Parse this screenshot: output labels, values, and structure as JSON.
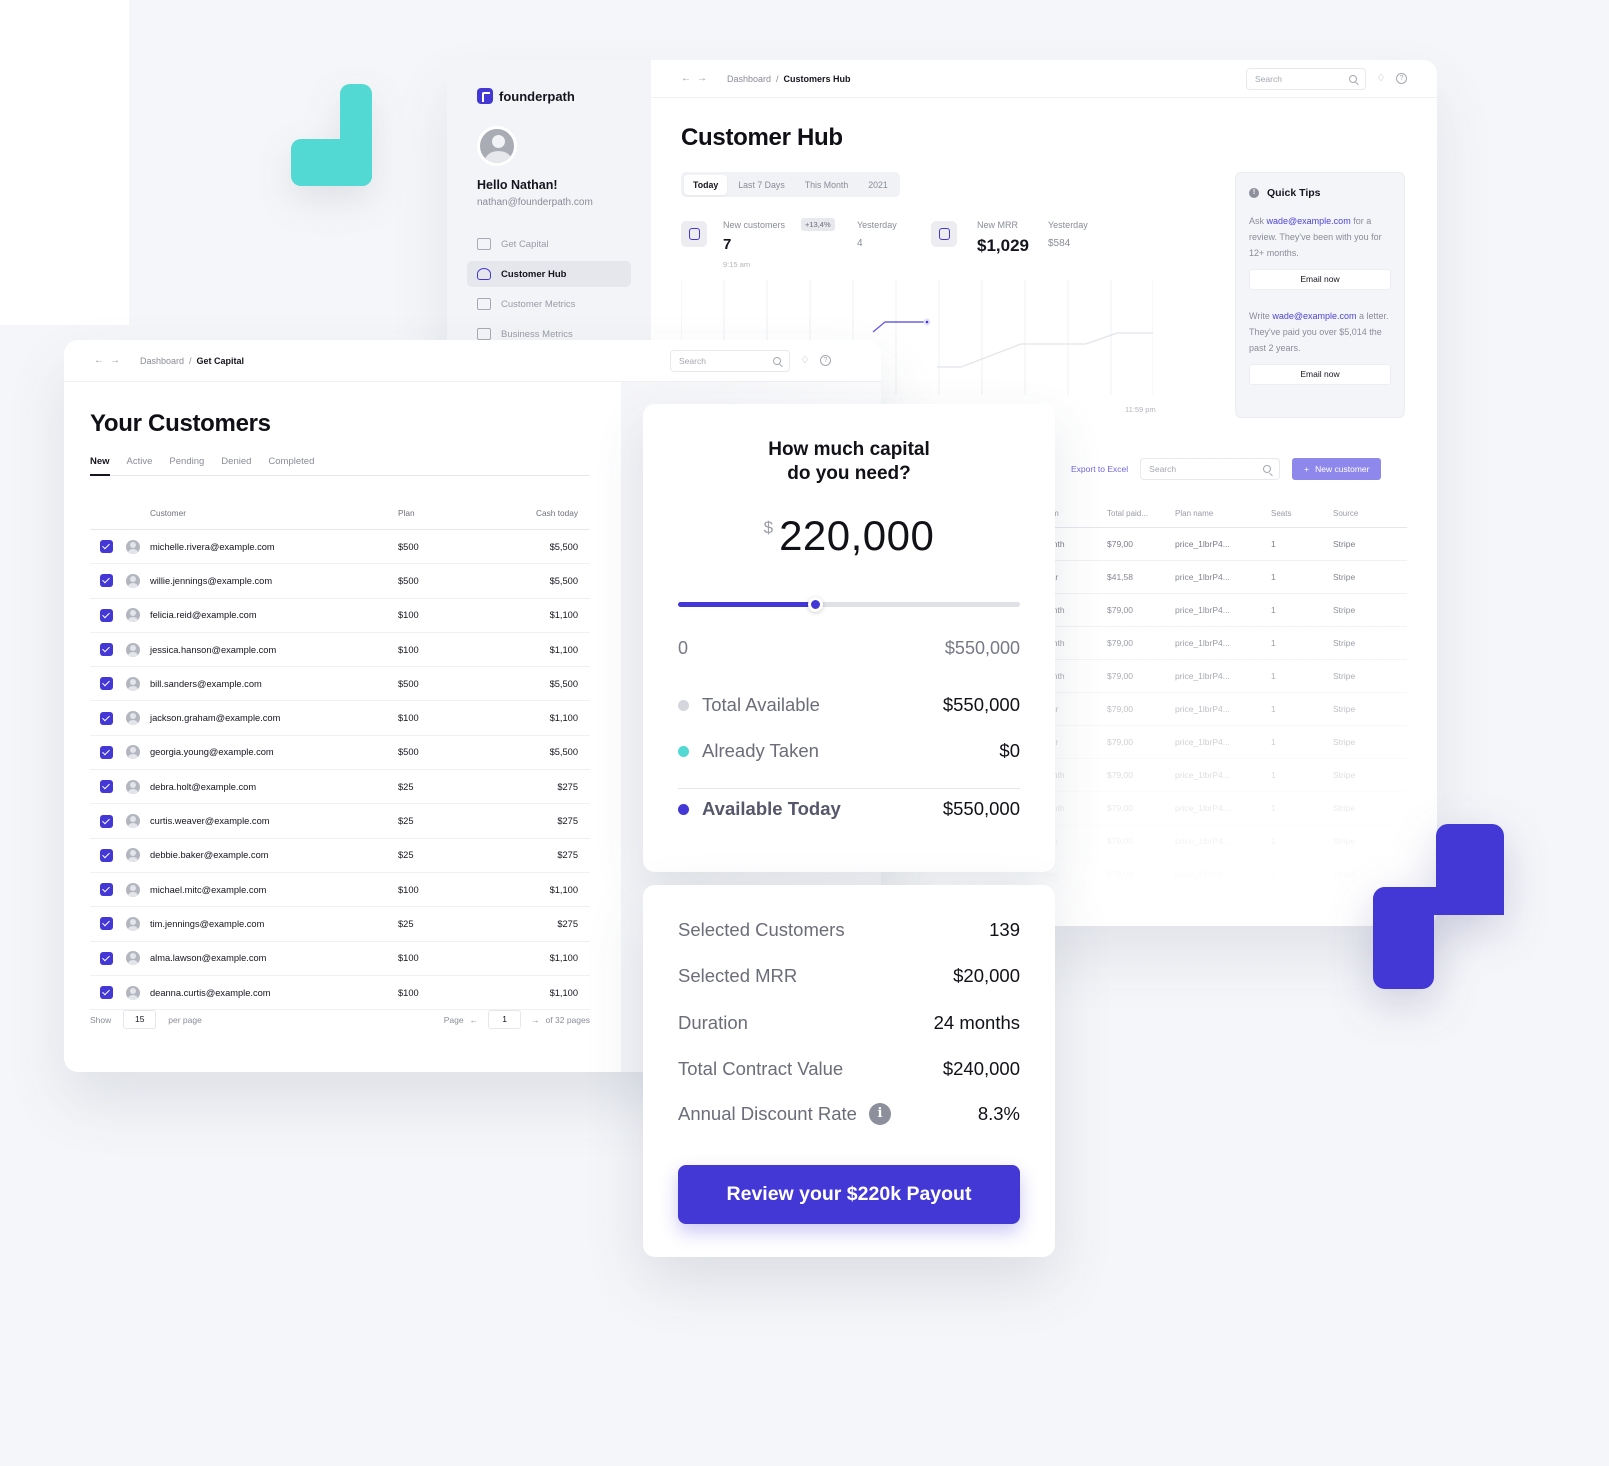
{
  "hub_window": {
    "brand": "founderpath",
    "greeting": "Hello Nathan!",
    "user_email": "nathan@founderpath.com",
    "nav": [
      {
        "label": "Get Capital",
        "icon": "capital-icon",
        "active": false
      },
      {
        "label": "Customer Hub",
        "icon": "users-icon",
        "active": true
      },
      {
        "label": "Customer Metrics",
        "icon": "chart-icon",
        "active": false
      },
      {
        "label": "Business Metrics",
        "icon": "bar-chart-icon",
        "active": false
      }
    ],
    "breadcrumb": {
      "parent": "Dashboard",
      "separator": "/",
      "current": "Customers Hub"
    },
    "search_placeholder": "Search",
    "title": "Customer Hub",
    "periods": [
      "Today",
      "Last 7 Days",
      "This Month",
      "2021"
    ],
    "active_period": "Today",
    "stats": {
      "new_customers": {
        "label": "New customers",
        "badge": "+13,4%",
        "value": "7",
        "time": "9:15 am",
        "yesterday_label": "Yesterday",
        "yesterday_value": "4"
      },
      "new_mrr": {
        "label": "New MRR",
        "value": "$1,029",
        "yesterday_label": "Yesterday",
        "yesterday_value": "$584"
      }
    },
    "chart_end_time": "11:59 pm",
    "quick_tips": {
      "title": "Quick Tips",
      "tips": [
        {
          "prefix": "Ask ",
          "link": "wade@example.com",
          "suffix": " for a review. They've been with you for 12+ months.",
          "button": "Email now"
        },
        {
          "prefix": "Write ",
          "link": "wade@example.com",
          "suffix": " a letter. They've paid you over $5,014 the past 2 years.",
          "button": "Email now"
        }
      ]
    },
    "table_tools": {
      "export_label": "Export to Excel",
      "search_placeholder": "Search",
      "new_button": "New customer"
    },
    "table": {
      "columns": [
        "Term",
        "Total paid...",
        "Plan name",
        "Seats",
        "Source"
      ],
      "rows": [
        [
          "Month",
          "$79,00",
          "price_1lbrP4...",
          "1",
          "Stripe"
        ],
        [
          "Year",
          "$41,58",
          "price_1lbrP4...",
          "1",
          "Stripe"
        ],
        [
          "Month",
          "$79,00",
          "price_1lbrP4...",
          "1",
          "Stripe"
        ],
        [
          "Month",
          "$79,00",
          "price_1lbrP4...",
          "1",
          "Stripe"
        ],
        [
          "Month",
          "$79,00",
          "price_1lbrP4...",
          "1",
          "Stripe"
        ],
        [
          "Year",
          "$79,00",
          "price_1lbrP4...",
          "1",
          "Stripe"
        ],
        [
          "Year",
          "$79,00",
          "price_1lbrP4...",
          "1",
          "Stripe"
        ],
        [
          "Month",
          "$79,00",
          "price_1lbrP4...",
          "1",
          "Stripe"
        ],
        [
          "Month",
          "$79,00",
          "price_1lbrP4...",
          "1",
          "Stripe"
        ],
        [
          "Year",
          "$79,00",
          "price_1lbrP4...",
          "1",
          "Stripe"
        ],
        [
          "Year",
          "$79,00",
          "price_1lbrP4...",
          "1",
          "Stripe"
        ]
      ]
    }
  },
  "customers_window": {
    "breadcrumb": {
      "parent": "Dashboard",
      "separator": "/",
      "current": "Get Capital"
    },
    "search_placeholder": "Search",
    "title": "Your Customers",
    "tabs": [
      "New",
      "Active",
      "Pending",
      "Denied",
      "Completed"
    ],
    "active_tab": "New",
    "columns": {
      "customer": "Customer",
      "plan": "Plan",
      "cash": "Cash today"
    },
    "rows": [
      {
        "email": "michelle.rivera@example.com",
        "plan": "$500",
        "cash": "$5,500",
        "checked": true
      },
      {
        "email": "willie.jennings@example.com",
        "plan": "$500",
        "cash": "$5,500",
        "checked": true
      },
      {
        "email": "felicia.reid@example.com",
        "plan": "$100",
        "cash": "$1,100",
        "checked": true
      },
      {
        "email": "jessica.hanson@example.com",
        "plan": "$100",
        "cash": "$1,100",
        "checked": true
      },
      {
        "email": "bill.sanders@example.com",
        "plan": "$500",
        "cash": "$5,500",
        "checked": true
      },
      {
        "email": "jackson.graham@example.com",
        "plan": "$100",
        "cash": "$1,100",
        "checked": true
      },
      {
        "email": "georgia.young@example.com",
        "plan": "$500",
        "cash": "$5,500",
        "checked": true
      },
      {
        "email": "debra.holt@example.com",
        "plan": "$25",
        "cash": "$275",
        "checked": true
      },
      {
        "email": "curtis.weaver@example.com",
        "plan": "$25",
        "cash": "$275",
        "checked": true
      },
      {
        "email": "debbie.baker@example.com",
        "plan": "$25",
        "cash": "$275",
        "checked": true
      },
      {
        "email": "michael.mitc@example.com",
        "plan": "$100",
        "cash": "$1,100",
        "checked": true
      },
      {
        "email": "tim.jennings@example.com",
        "plan": "$25",
        "cash": "$275",
        "checked": true
      },
      {
        "email": "alma.lawson@example.com",
        "plan": "$100",
        "cash": "$1,100",
        "checked": true
      },
      {
        "email": "deanna.curtis@example.com",
        "plan": "$100",
        "cash": "$1,100",
        "checked": true
      }
    ],
    "pagination": {
      "show_label": "Show",
      "per_page_value": "15",
      "per_page_label": "per page",
      "page_label": "Page",
      "current_page": "1",
      "total_label": "of 32 pages"
    }
  },
  "capital_card": {
    "title_line1": "How much capital",
    "title_line2": "do you need?",
    "currency_symbol": "$",
    "amount": "220,000",
    "slider_min_label": "0",
    "slider_max_label": "$550,000",
    "slider_fraction": 0.4,
    "legend": [
      {
        "label": "Total Available",
        "value": "$550,000",
        "color": "#d5d6dd"
      },
      {
        "label": "Already Taken",
        "value": "$0",
        "color": "#52d9d4"
      },
      {
        "label": "Available Today",
        "value": "$550,000",
        "color": "#4338d6"
      }
    ]
  },
  "summary_card": {
    "rows": [
      {
        "label": "Selected Customers",
        "value": "139"
      },
      {
        "label": "Selected MRR",
        "value": "$20,000"
      },
      {
        "label": "Duration",
        "value": "24 months"
      },
      {
        "label": "Total Contract Value",
        "value": "$240,000"
      },
      {
        "label": "Annual Discount Rate",
        "value": "8.3%",
        "info": true
      }
    ],
    "cta_label": "Review your $220k Payout"
  },
  "colors": {
    "accent": "#4338d6",
    "teal": "#52d9d4",
    "background": "#f5f6f9"
  }
}
